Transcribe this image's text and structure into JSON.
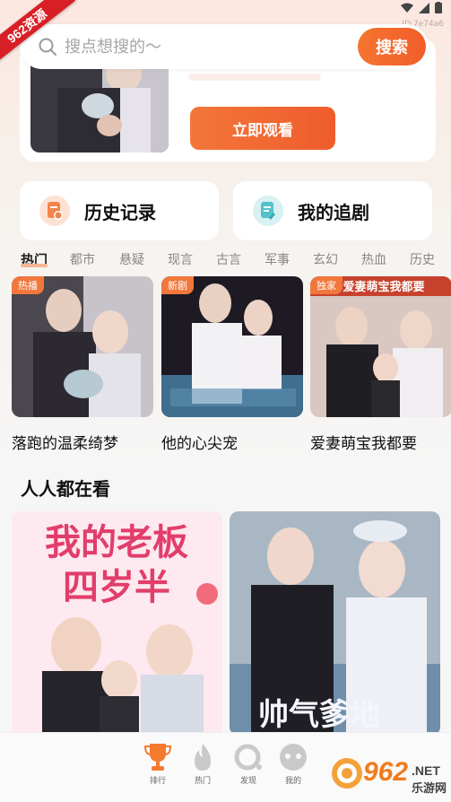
{
  "ribbon": "962资源",
  "device_id": "ID:7e74a6",
  "search": {
    "placeholder": "搜点想搜的～",
    "button": "搜索"
  },
  "hero": {
    "watch_button": "立即观看"
  },
  "quick": {
    "history": "历史记录",
    "follow": "我的追剧"
  },
  "tabs": [
    "热门",
    "都市",
    "悬疑",
    "现言",
    "古言",
    "军事",
    "玄幻",
    "热血",
    "历史"
  ],
  "dramas": [
    {
      "badge": "热播",
      "title": "落跑的温柔绮梦"
    },
    {
      "badge": "新剧",
      "title": "他的心尖宠"
    },
    {
      "badge": "独家",
      "title": "爱妻萌宝我都要"
    }
  ],
  "poster_text": {
    "drama3_banner": "爱妻萌宝我都要",
    "big1_line1": "我的老板",
    "big1_line2": "四岁半",
    "big2_text": "帅气爹地"
  },
  "section": {
    "title": "人人都在看"
  },
  "nav": [
    "排行",
    "热门",
    "发现",
    "我的"
  ],
  "logo": {
    "main": "962",
    "suffix": ".NET",
    "sub": "乐游网"
  },
  "colors": {
    "accent": "#f2652c",
    "badge": "#f2773b"
  }
}
